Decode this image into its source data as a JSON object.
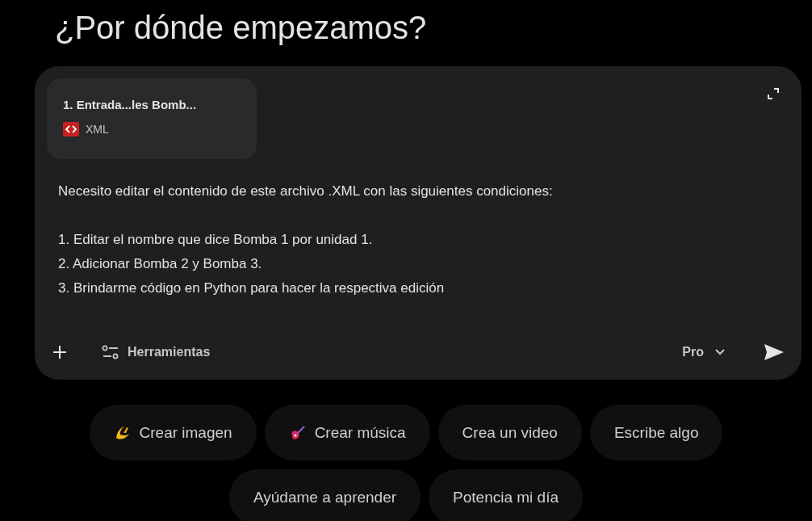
{
  "heading": "¿Por dónde empezamos?",
  "attachment": {
    "name": "1. Entrada...les Bomb...",
    "type": "XML"
  },
  "prompt": {
    "intro": "Necesito editar el contenido de este archivo .XML con las siguientes condiciones:",
    "items": [
      "1. Editar el nombre que dice Bomba 1 por unidad 1.",
      "2. Adicionar Bomba 2 y Bomba 3.",
      "3. Brindarme código en Python para hacer la respectiva edición"
    ]
  },
  "toolbar": {
    "tools_label": "Herramientas",
    "model": "Pro"
  },
  "suggestion_rows": [
    [
      {
        "label": "Crear imagen",
        "kind": "image"
      },
      {
        "label": "Crear música",
        "kind": "music"
      },
      {
        "label": "Crea un video",
        "kind": "plain"
      },
      {
        "label": "Escribe algo",
        "kind": "plain"
      }
    ],
    [
      {
        "label": "Ayúdame a aprender",
        "kind": "plain"
      },
      {
        "label": "Potencia mi día",
        "kind": "plain"
      }
    ]
  ]
}
